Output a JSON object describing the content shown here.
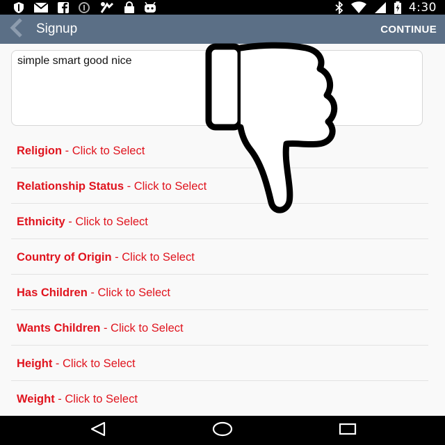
{
  "status_bar": {
    "time": "4:30",
    "left_icons": [
      "shield-icon",
      "mail-icon",
      "facebook-icon",
      "circle-icon",
      "fail-icon",
      "lock-icon",
      "android-icon"
    ],
    "right_icons": [
      "bluetooth-icon",
      "wifi-icon",
      "signal-icon",
      "battery-icon"
    ]
  },
  "action_bar": {
    "title": "Signup",
    "continue_label": "CONTINUE",
    "background": "#5b6f86"
  },
  "bio": {
    "text": "simple smart good nice"
  },
  "fields": [
    {
      "name": "Religion",
      "action": " - Click to Select"
    },
    {
      "name": "Relationship Status",
      "action": " - Click to Select"
    },
    {
      "name": "Ethnicity",
      "action": " - Click to Select"
    },
    {
      "name": "Country of Origin",
      "action": " - Click to Select"
    },
    {
      "name": "Has Children",
      "action": " - Click to Select"
    },
    {
      "name": "Wants Children",
      "action": " - Click to Select"
    },
    {
      "name": "Height",
      "action": " - Click to Select"
    },
    {
      "name": "Weight",
      "action": " - Click to Select"
    }
  ],
  "colors": {
    "field_text": "#e0141e",
    "status_bar": "#000000",
    "nav_bar": "#000000"
  },
  "overlay": {
    "icon": "thumbs-down-icon"
  },
  "nav_bar": {
    "icons": [
      "back-icon",
      "home-icon",
      "recents-icon"
    ]
  }
}
